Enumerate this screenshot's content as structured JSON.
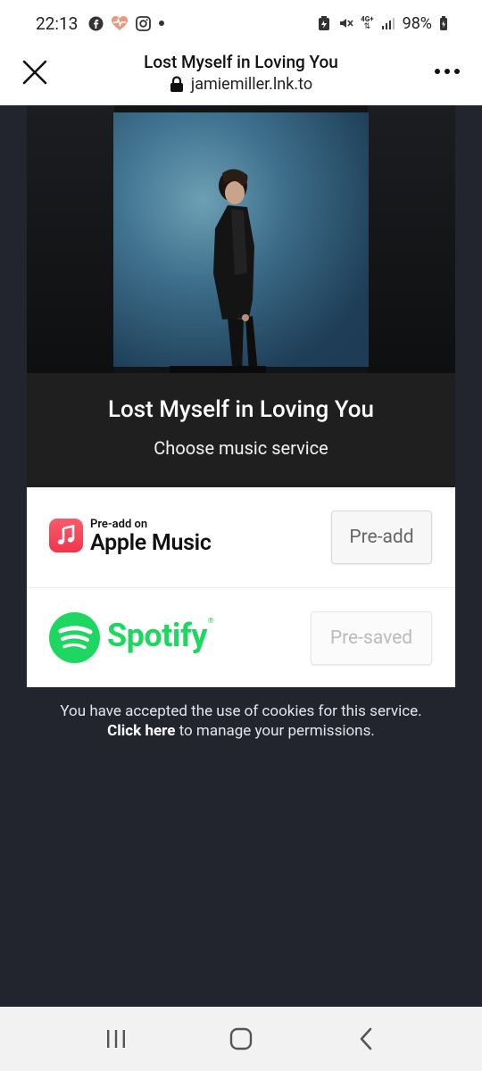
{
  "status_bar": {
    "time": "22:13",
    "icons_left": [
      "facebook-icon",
      "health-heart-icon",
      "instagram-icon",
      "dot-icon"
    ],
    "icons_right": [
      "battery-saver-icon",
      "mute-icon",
      "network-4g-icon",
      "signal-icon"
    ],
    "network_label": "4G+",
    "battery": "98%"
  },
  "browser": {
    "title": "Lost Myself in Loving You",
    "url": "jamiemiller.lnk.to"
  },
  "release": {
    "title": "Lost Myself in Loving You",
    "subtitle": "Choose music service"
  },
  "services": [
    {
      "name": "Apple Music",
      "tagline": "Pre-add on",
      "button": "Pre-add",
      "state": "active"
    },
    {
      "name": "Spotify",
      "registered_mark": "®",
      "button": "Pre-saved",
      "state": "disabled"
    }
  ],
  "cookie": {
    "line1": "You have accepted the use of cookies for this service.",
    "link": "Click here",
    "line2_rest": " to manage your permissions."
  },
  "colors": {
    "spotify_green": "#1ed760",
    "apple_red": "#f2344c",
    "page_bg": "#23252e",
    "panel_bg": "#1f1f1f"
  }
}
